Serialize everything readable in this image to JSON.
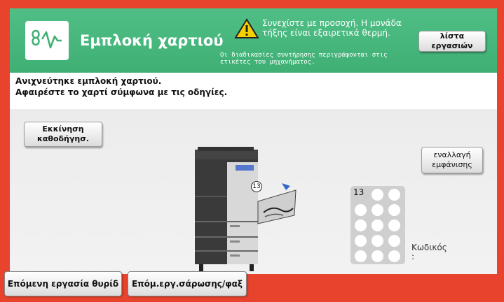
{
  "header": {
    "title": "Εμπλοκή χαρτιού",
    "warning_text": "Συνεχίστε με προσοχή. Η μονάδα τήξης είναι εξαιρετικά θερμή.",
    "sub_text": "Οι διαδικασίες συντήρησης περιγράφονται στις ετικέτες του μηχανήματος.",
    "job_list_button": "λίστα εργασιών"
  },
  "message": {
    "line1": "Ανιχνεύτηκε εμπλοκή χαρτιού.",
    "line2": "Αφαιρέστε το χαρτί σύμφωνα με τις οδηγίες."
  },
  "buttons": {
    "start_guide": "Εκκίνηση καθοδήγησ.",
    "switch_view": "εναλλαγή εμφάνισης"
  },
  "machine": {
    "location_number": "13"
  },
  "keypad": {
    "count": "13",
    "code_label": "Κωδικός",
    "code_value": ":"
  },
  "bottom": {
    "next_job_button": "Επόμενη εργασία θυρίδ",
    "scan_fax_button": "Επόμ.εργ.σάρωσης/φαξ"
  }
}
